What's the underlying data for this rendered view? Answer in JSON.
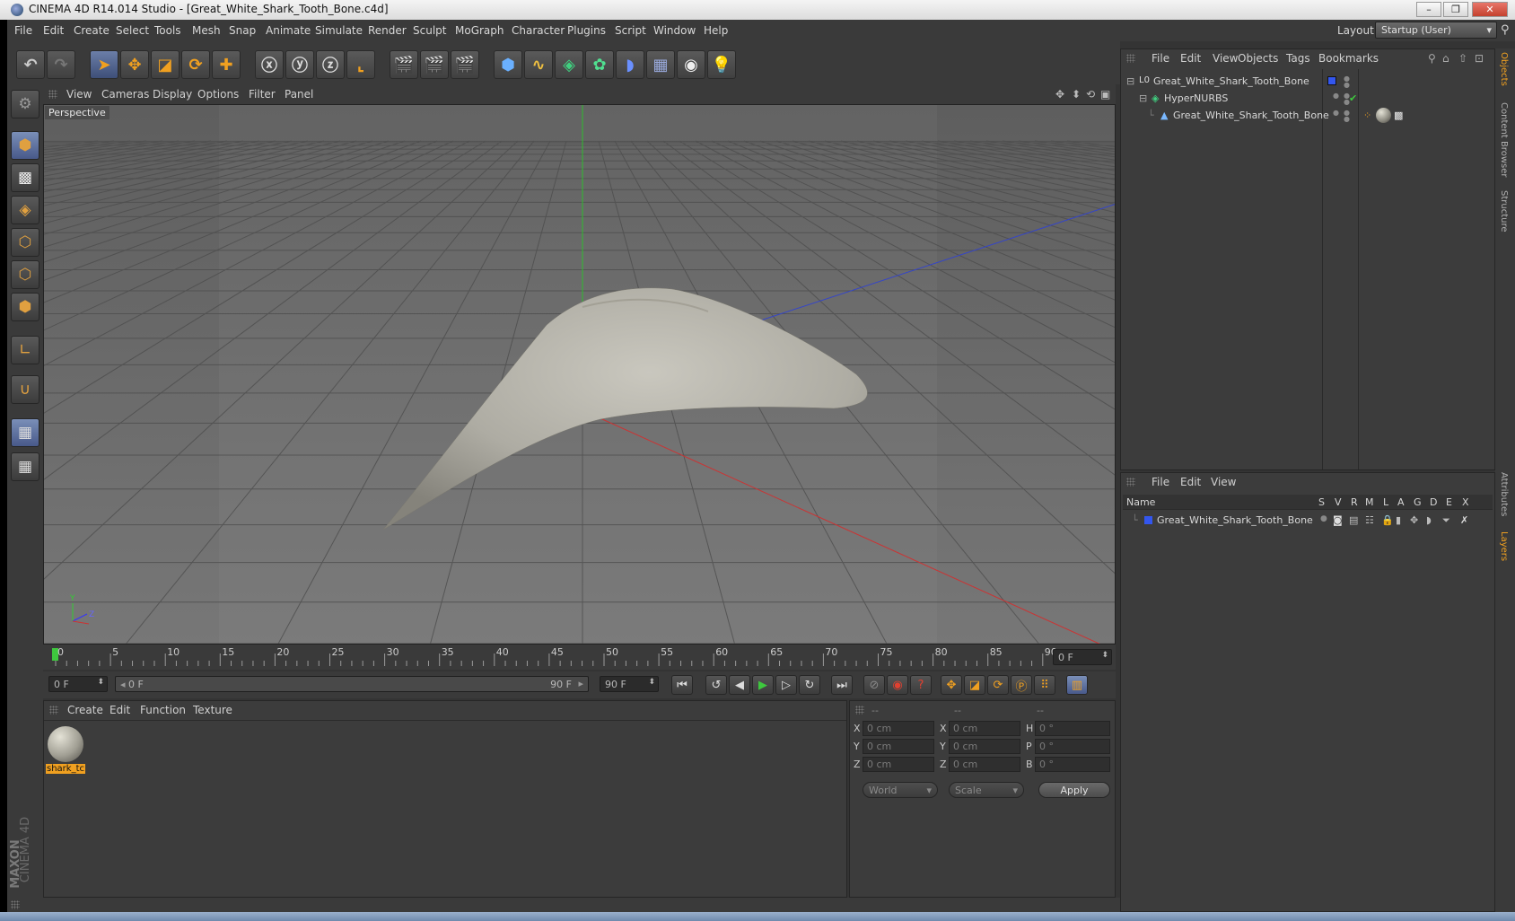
{
  "window": {
    "title": "CINEMA 4D R14.014 Studio - [Great_White_Shark_Tooth_Bone.c4d]"
  },
  "menu": {
    "items": [
      "File",
      "Edit",
      "Create",
      "Select",
      "Tools",
      "Mesh",
      "Snap",
      "Animate",
      "Simulate",
      "Render",
      "Sculpt",
      "MoGraph",
      "Character",
      "Plugins",
      "Script",
      "Window",
      "Help"
    ],
    "layout_label": "Layout:",
    "layout_value": "Startup (User)"
  },
  "viewport": {
    "menu": [
      "View",
      "Cameras",
      "Display",
      "Options",
      "Filter",
      "Panel"
    ],
    "label": "Perspective",
    "axis_y": "Y",
    "axis_z": "Z"
  },
  "timeline": {
    "ticks": [
      "0",
      "5",
      "10",
      "15",
      "20",
      "25",
      "30",
      "35",
      "40",
      "45",
      "50",
      "55",
      "60",
      "65",
      "70",
      "75",
      "80",
      "85",
      "90"
    ],
    "current_frame": "0 F",
    "start_field": "0 F",
    "range_start": "0 F",
    "range_end": "90 F",
    "end_field": "90 F"
  },
  "objects": {
    "menu": [
      "File",
      "Edit",
      "View",
      "Objects",
      "Tags",
      "Bookmarks"
    ],
    "rows": [
      {
        "name": "Great_White_Shark_Tooth_Bone"
      },
      {
        "name": "HyperNURBS"
      },
      {
        "name": "Great_White_Shark_Tooth_Bone"
      }
    ]
  },
  "layers": {
    "menu": [
      "File",
      "Edit",
      "View"
    ],
    "columns": [
      "Name",
      "S",
      "V",
      "R",
      "M",
      "L",
      "A",
      "G",
      "D",
      "E",
      "X"
    ],
    "rows": [
      {
        "name": "Great_White_Shark_Tooth_Bone"
      }
    ]
  },
  "materials": {
    "menu": [
      "Create",
      "Edit",
      "Function",
      "Texture"
    ],
    "items": [
      {
        "name": "shark_tc"
      }
    ]
  },
  "coordinates": {
    "headers": [
      "--",
      "--",
      "--"
    ],
    "rows": [
      {
        "pos_label": "X",
        "pos": "0 cm",
        "size_label": "X",
        "size": "0 cm",
        "rot_label": "H",
        "rot": "0 °"
      },
      {
        "pos_label": "Y",
        "pos": "0 cm",
        "size_label": "Y",
        "size": "0 cm",
        "rot_label": "P",
        "rot": "0 °"
      },
      {
        "pos_label": "Z",
        "pos": "0 cm",
        "size_label": "Z",
        "size": "0 cm",
        "rot_label": "B",
        "rot": "0 °"
      }
    ],
    "mode": "World",
    "transform": "Scale",
    "apply": "Apply"
  },
  "side_tabs": [
    "Objects",
    "Content Browser",
    "Structure",
    "Attributes",
    "Layers"
  ],
  "branding": {
    "line1": "MAXON",
    "line2": "CINEMA 4D"
  },
  "colors": {
    "accent_orange": "#f0a020",
    "x_axis": "#c83030",
    "y_axis": "#30b030",
    "z_axis": "#3040d0",
    "tooth": "#b9b7ad"
  }
}
